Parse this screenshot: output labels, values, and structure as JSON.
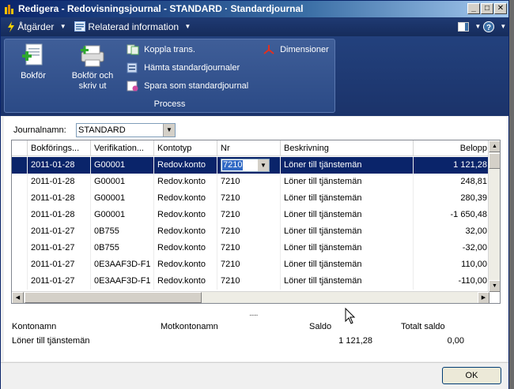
{
  "window": {
    "title": "Redigera - Redovisningsjournal - STANDARD · Standardjournal",
    "min_glyph": "_",
    "max_glyph": "□",
    "close_glyph": "✕"
  },
  "commandbar": {
    "actions_label": "Åtgärder",
    "related_label": "Relaterad information"
  },
  "ribbon": {
    "group_label": "Process",
    "post_label": "Bokför",
    "post_print_label": "Bokför och skriv ut",
    "apply_entries_label": "Koppla trans.",
    "get_standard_label": "Hämta standardjournaler",
    "save_standard_label": "Spara som standardjournal",
    "dimensions_label": "Dimensioner"
  },
  "journal": {
    "label": "Journalnamn:",
    "value": "STANDARD"
  },
  "grid": {
    "columns": [
      "Bokförings...",
      "Verifikation...",
      "Kontotyp",
      "Nr",
      "Beskrivning",
      "Belopp"
    ],
    "rows": [
      [
        "2011-01-28",
        "G00001",
        "Redov.konto",
        "7210",
        "Löner till tjänstemän",
        "1 121,28"
      ],
      [
        "2011-01-28",
        "G00001",
        "Redov.konto",
        "7210",
        "Löner till tjänstemän",
        "248,81"
      ],
      [
        "2011-01-28",
        "G00001",
        "Redov.konto",
        "7210",
        "Löner till tjänstemän",
        "280,39"
      ],
      [
        "2011-01-28",
        "G00001",
        "Redov.konto",
        "7210",
        "Löner till tjänstemän",
        "-1 650,48"
      ],
      [
        "2011-01-27",
        "0B755",
        "Redov.konto",
        "7210",
        "Löner till tjänstemän",
        "32,00"
      ],
      [
        "2011-01-27",
        "0B755",
        "Redov.konto",
        "7210",
        "Löner till tjänstemän",
        "-32,00"
      ],
      [
        "2011-01-27",
        "0E3AAF3D-F1",
        "Redov.konto",
        "7210",
        "Löner till tjänstemän",
        "110,00"
      ],
      [
        "2011-01-27",
        "0E3AAF3D-F1",
        "Redov.konto",
        "7210",
        "Löner till tjänstemän",
        "-110,00"
      ]
    ]
  },
  "splitter": "......",
  "info": {
    "account_name_label": "Kontonamn",
    "bal_account_name_label": "Motkontonamn",
    "balance_label": "Saldo",
    "total_balance_label": "Totalt saldo",
    "account_name_value": "Löner till tjänstemän",
    "bal_account_name_value": "",
    "balance_value": "1 121,28",
    "total_balance_value": "0,00"
  },
  "footer": {
    "ok_label": "OK"
  }
}
